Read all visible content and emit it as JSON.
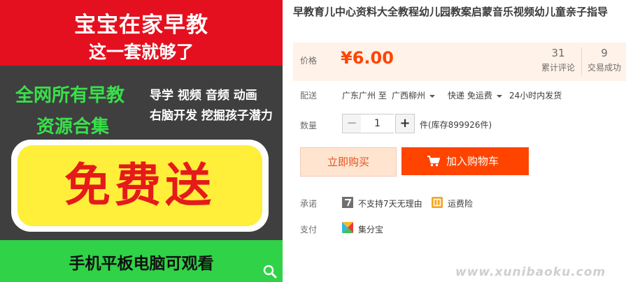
{
  "product_image": {
    "header_line1": "宝宝在家早教",
    "header_line2": "这一套就够了",
    "green_line1": "全网所有早教",
    "green_line2": "资源合集",
    "white_line1": "导学 视频 音频 动画",
    "white_line2": "右脑开发 挖掘孩子潜力",
    "badge": "免费送",
    "bottom": "手机平板电脑可观看",
    "zoom_icon": "magnifier-icon"
  },
  "product": {
    "title": "早教育儿中心资料大全教程幼儿园教案启蒙音乐视频幼儿童亲子指导"
  },
  "price": {
    "label": "价格",
    "value": "¥6.00",
    "reviews_count": "31",
    "reviews_label": "累计评论",
    "sales_count": "9",
    "sales_label": "交易成功"
  },
  "shipping": {
    "label": "配送",
    "from": "广东广州 至",
    "to": "广西柳州",
    "method": "快递 免运费",
    "delivery": "24小时内发货"
  },
  "quantity": {
    "label": "数量",
    "value": "1",
    "stock": "件(库存899926件)"
  },
  "buttons": {
    "buy_now": "立即购买",
    "add_to_cart": "加入购物车"
  },
  "promise": {
    "label": "承诺",
    "item1": "不支持7天无理由",
    "item2": "运费险"
  },
  "payment": {
    "label": "支付",
    "method": "集分宝"
  },
  "watermark": "www.xunibaoku.com",
  "colors": {
    "accent": "#ff4400",
    "price_bg": "#fff2e8",
    "red_banner": "#e4101f",
    "green_banner": "#30d247"
  }
}
